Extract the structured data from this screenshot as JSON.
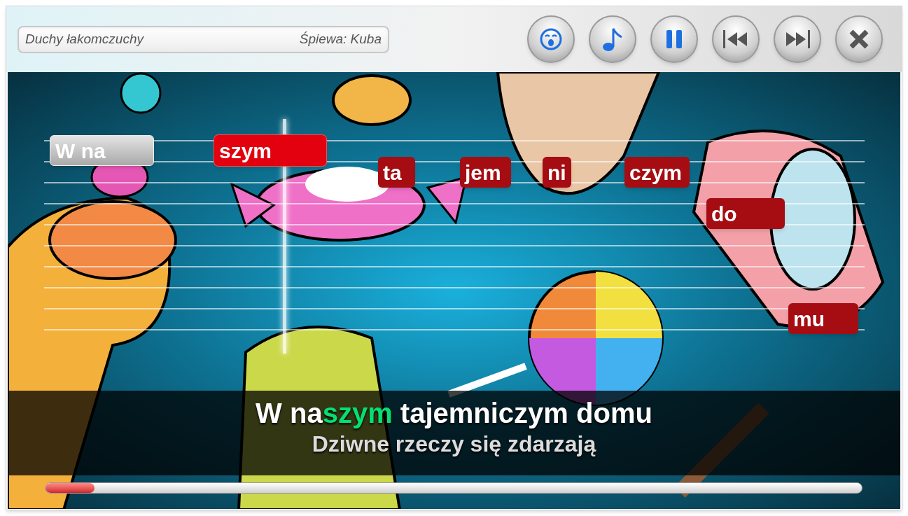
{
  "header": {
    "song_title": "Duchy łakomczuchy",
    "singer": "Śpiewa: Kuba"
  },
  "notes": [
    {
      "text": "W na",
      "sung": true,
      "current": false
    },
    {
      "text": "szym",
      "sung": false,
      "current": true
    },
    {
      "text": "ta",
      "sung": false,
      "current": false
    },
    {
      "text": "jem",
      "sung": false,
      "current": false
    },
    {
      "text": "ni",
      "sung": false,
      "current": false
    },
    {
      "text": "czym",
      "sung": false,
      "current": false
    },
    {
      "text": "do",
      "sung": false,
      "current": false
    },
    {
      "text": "mu",
      "sung": false,
      "current": false
    }
  ],
  "lyrics": {
    "current_line": [
      {
        "text": "W na",
        "highlighted": false
      },
      {
        "text": "szym",
        "highlighted": true
      },
      {
        "text": " tajemniczym domu",
        "highlighted": false
      }
    ],
    "next_line": "Dziwne rzeczy się zdarzają"
  },
  "progress": {
    "level": 0.06
  }
}
